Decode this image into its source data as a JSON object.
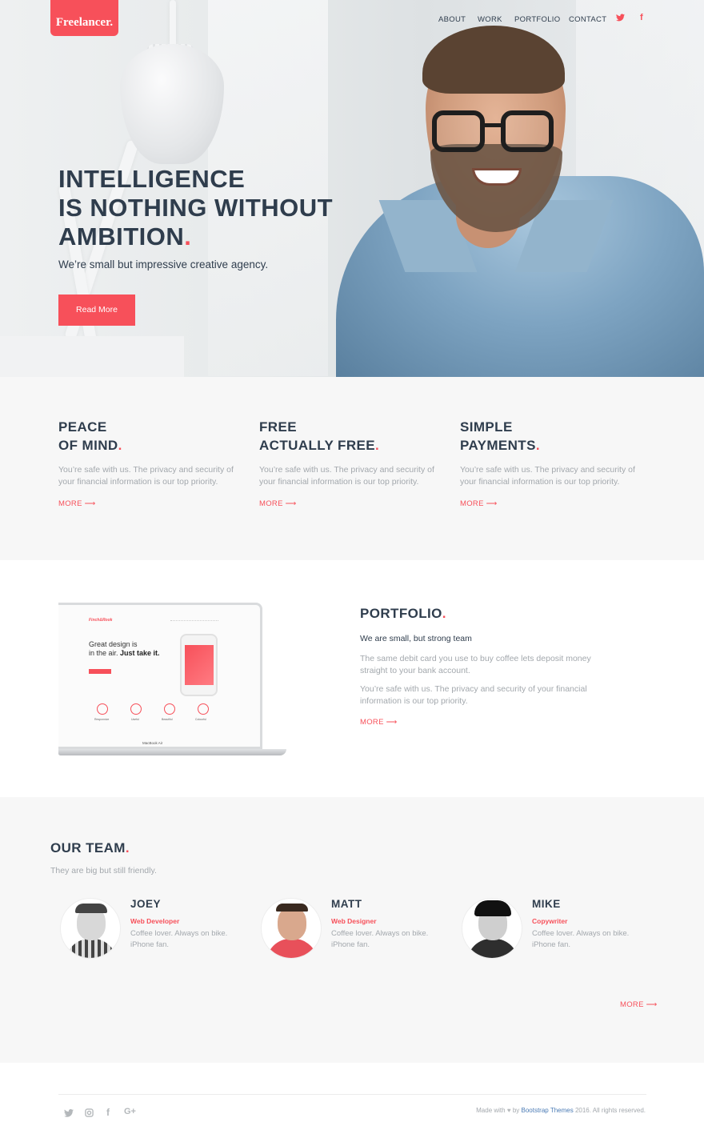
{
  "brand": {
    "logo": "Freelancer."
  },
  "nav": {
    "items": [
      "ABOUT",
      "WORK",
      "PORTFOLIO",
      "CONTACT"
    ],
    "icons": [
      "twitter-icon",
      "facebook-icon"
    ]
  },
  "hero": {
    "title_lines": [
      "INTELLIGENCE",
      "IS NOTHING WITHOUT",
      "AMBITION"
    ],
    "title_dot": ".",
    "subtitle": "We’re small but impressive creative agency.",
    "button": "Read More"
  },
  "features": [
    {
      "line1": "PEACE",
      "line2": "OF MIND",
      "text": "You’re safe with us. The privacy and security of your financial information is our top priority.",
      "more": "MORE ⟶"
    },
    {
      "line1": "FREE",
      "line2": "ACTUALLY FREE",
      "text": "You’re safe with us. The privacy and security of your financial information is our top priority.",
      "more": "MORE ⟶"
    },
    {
      "line1": "SIMPLE",
      "line2": "PAYMENTS",
      "text": "You’re safe with us. The privacy and security of your financial information is our top priority.",
      "more": "MORE ⟶"
    }
  ],
  "portfolio": {
    "title": "PORTFOLIO",
    "lead": "We are small, but strong team",
    "p1": "The same debit card you use to buy coffee lets deposit money straight to your bank account.",
    "p2": "You’re safe with us. The privacy and security of your financial information is our top priority.",
    "more": "MORE ⟶",
    "screen": {
      "brand": "Finch&Rook",
      "heading1": "Great design is",
      "heading2a": "in the air. ",
      "heading2b": "Just take it.",
      "features": [
        "Responsive",
        "Useful",
        "Beautiful",
        "Colourful"
      ],
      "model": "MacBook Air"
    }
  },
  "team": {
    "title": "OUR TEAM",
    "subtitle": "They are big but still friendly.",
    "members": [
      {
        "name": "JOEY",
        "role": "Web Developer",
        "bio": "Coffee lover. Always on bike. iPhone fan."
      },
      {
        "name": "MATT",
        "role": "Web Designer",
        "bio": "Coffee lover. Always on bike. iPhone fan."
      },
      {
        "name": "MIKE",
        "role": "Copywriter",
        "bio": "Coffee lover. Always on bike. iPhone fan."
      }
    ],
    "more": "MORE ⟶"
  },
  "footer": {
    "social_icons": [
      "twitter-icon",
      "instagram-icon",
      "facebook-icon",
      "google-plus-icon"
    ],
    "credit_pre": "Made with",
    "credit_by": "by",
    "credit_brand": "Bootstrap Themes",
    "credit_post": "2016. All rights reserved."
  },
  "colors": {
    "accent": "#f7505a",
    "heading": "#2f3d4d",
    "muted": "#a3a8ad",
    "section_bg": "#f7f7f7"
  }
}
